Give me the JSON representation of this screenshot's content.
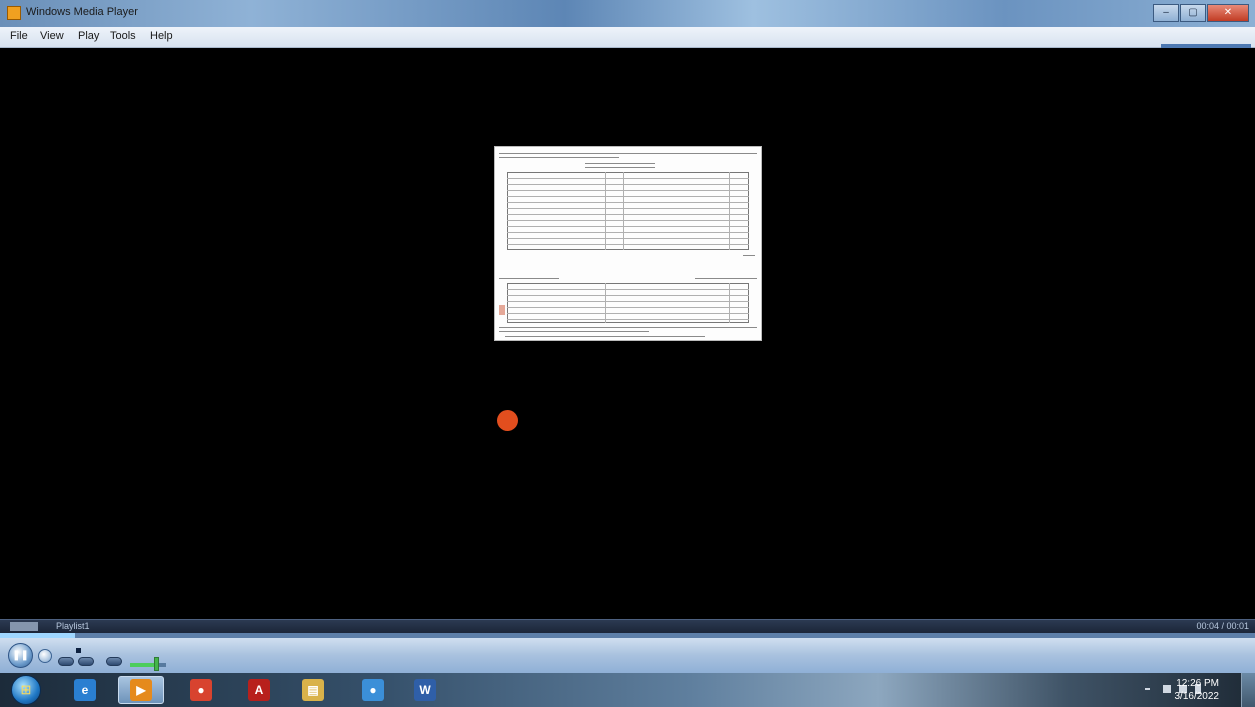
{
  "window": {
    "title": "Windows Media Player",
    "controls": {
      "minimize": "–",
      "maximize": "▢",
      "close": "✕"
    }
  },
  "menu": {
    "items": [
      "File",
      "View",
      "Play",
      "Tools",
      "Help"
    ]
  },
  "playlist": {
    "label": "Playlist1",
    "time": "00:04 / 00:01"
  },
  "playback": {
    "progress_fraction": 0.06,
    "volume_fraction": 0.75
  },
  "taskbar": {
    "start_icon": "windows-start-icon",
    "apps": [
      {
        "name": "internet-explorer",
        "icon": "e",
        "color": "#2a7fd1",
        "active": false
      },
      {
        "name": "windows-media-player",
        "icon": "▶",
        "color": "#e58a1c",
        "active": true
      },
      {
        "name": "chrome",
        "icon": "●",
        "color": "#d8432f",
        "active": false
      },
      {
        "name": "adobe-acrobat",
        "icon": "A",
        "color": "#b8201c",
        "active": false
      },
      {
        "name": "file-explorer",
        "icon": "▤",
        "color": "#d9b24a",
        "active": false
      },
      {
        "name": "chrome-profile",
        "icon": "●",
        "color": "#3b8fd8",
        "active": false
      },
      {
        "name": "word-document",
        "icon": "W",
        "color": "#2f5fa8",
        "active": false
      }
    ],
    "clock": {
      "time": "12:26 PM",
      "date": "3/16/2022"
    }
  }
}
